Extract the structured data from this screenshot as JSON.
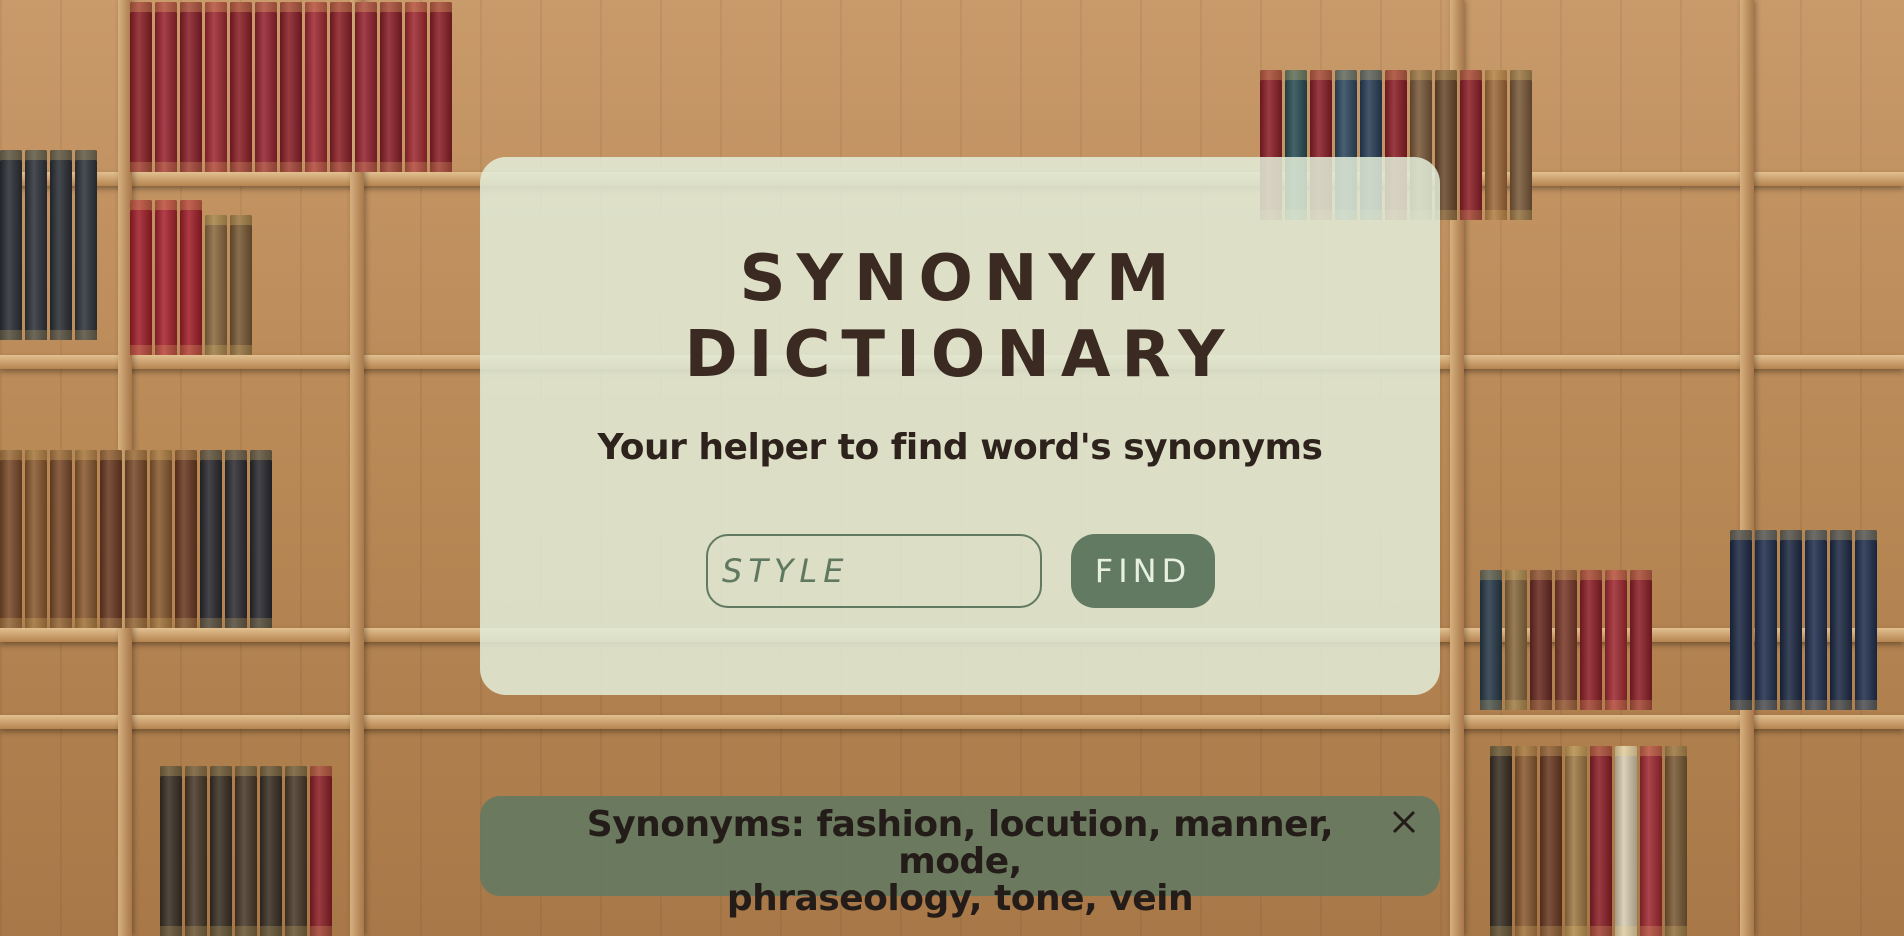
{
  "app": {
    "title_line1": "SYNONYM",
    "title_line2": "DICTIONARY",
    "subtitle": "Your helper to find word's synonyms"
  },
  "search": {
    "placeholder": "STYLE",
    "button_label": "FIND"
  },
  "result": {
    "text_line1": "Synonyms: fashion, locution, manner, mode,",
    "text_line2": "phraseology, tone, vein"
  },
  "icons": {
    "close": "close-icon"
  },
  "colors": {
    "accent": "#627a62",
    "card": "#e2ecd8",
    "title": "#3a2a22"
  }
}
